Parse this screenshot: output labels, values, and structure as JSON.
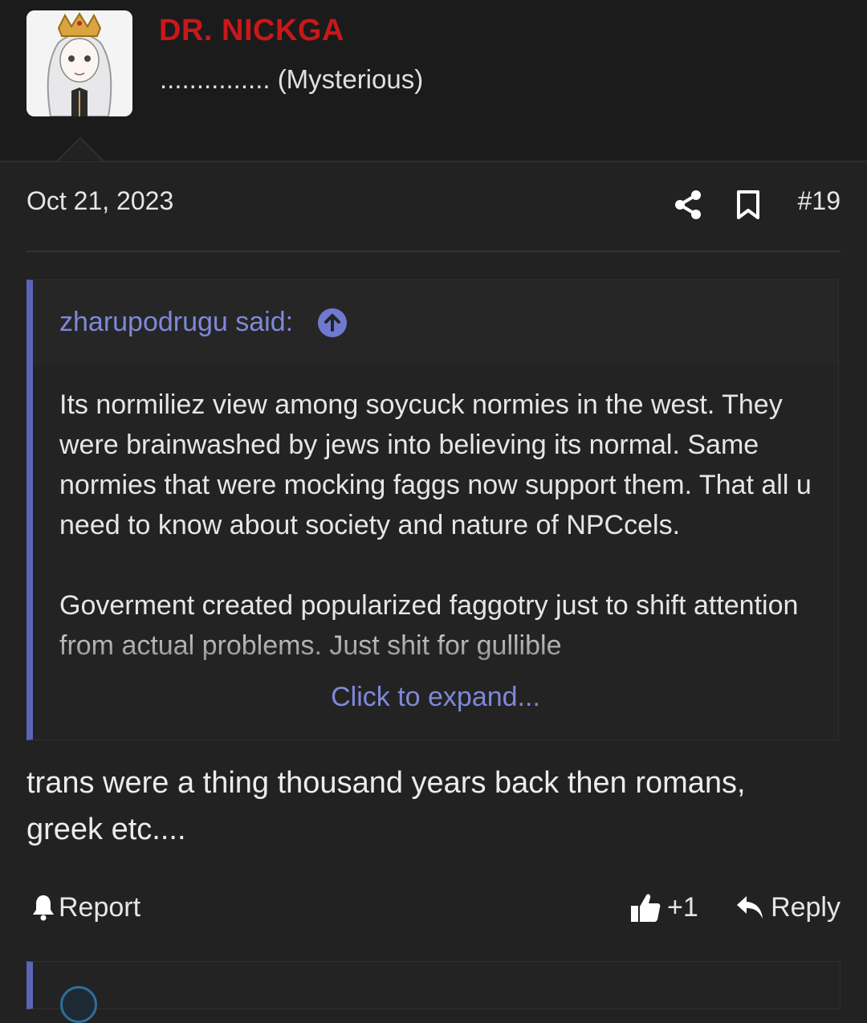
{
  "user": {
    "name": "DR. NICKGA",
    "title": "............... (Mysterious)"
  },
  "post": {
    "date": "Oct 21, 2023",
    "number": "#19",
    "body": "trans were a thing thousand years back then romans, greek etc...."
  },
  "quote": {
    "author": "zharupodrugu said:",
    "paragraph1": "Its normiliez view among soycuck normies in the west. They were brainwashed by jews into believing its normal. Same normies that were mocking faggs now support them. That all u need to know about society and nature of NPCcels.",
    "paragraph2": "Goverment created popularized faggotry just to shift attention from actual problems. Just shit for gullible",
    "expand_label": "Click to expand..."
  },
  "actions": {
    "report": "Report",
    "like_count": "+1",
    "reply": "Reply"
  },
  "colors": {
    "username": "#c8181a",
    "accent": "#7f88d8",
    "quote_border": "#5a65b9",
    "background": "#222222"
  },
  "icons": [
    "share-icon",
    "bookmark-icon",
    "arrow-circle-up-icon",
    "bell-icon",
    "thumbs-up-icon",
    "reply-arrow-icon"
  ]
}
